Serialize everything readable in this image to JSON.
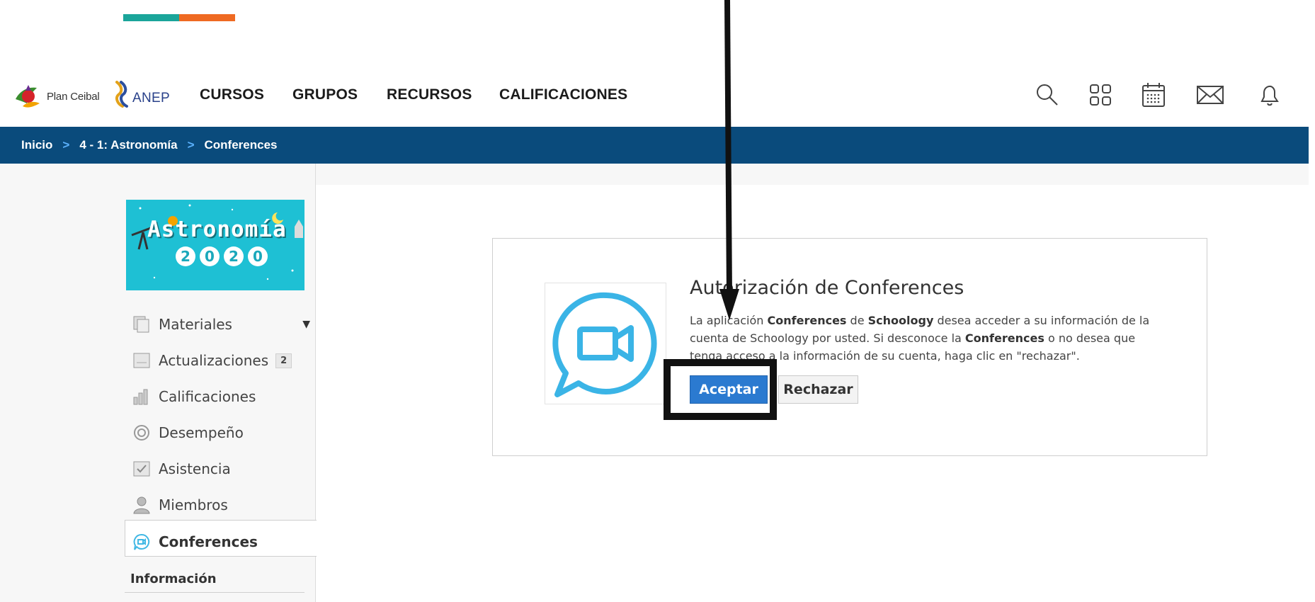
{
  "logos": {
    "ceibal_text": "Plan Ceibal",
    "anep_text": "ANEP"
  },
  "nav": {
    "items": [
      {
        "label": "CURSOS"
      },
      {
        "label": "GRUPOS"
      },
      {
        "label": "RECURSOS"
      },
      {
        "label": "CALIFICACIONES"
      }
    ],
    "icons": [
      "search-icon",
      "apps-grid-icon",
      "calendar-icon",
      "mail-icon",
      "bell-icon"
    ]
  },
  "breadcrumb": {
    "items": [
      "Inicio",
      "4 - 1: Astronomía",
      "Conferences"
    ],
    "separator": ">"
  },
  "course": {
    "image_title": "Astronomía",
    "image_year": [
      "2",
      "0",
      "2",
      "0"
    ]
  },
  "sidebar": {
    "items": [
      {
        "label": "Materiales",
        "icon": "materials-icon"
      },
      {
        "label": "Actualizaciones",
        "icon": "updates-icon",
        "badge": "2"
      },
      {
        "label": "Calificaciones",
        "icon": "grades-icon"
      },
      {
        "label": "Desempeño",
        "icon": "performance-icon"
      },
      {
        "label": "Asistencia",
        "icon": "attendance-icon"
      },
      {
        "label": "Miembros",
        "icon": "members-icon"
      },
      {
        "label": "Conferences",
        "icon": "conferences-icon",
        "active": true
      }
    ],
    "info_label": "Información"
  },
  "auth": {
    "title": "Autorización de Conferences",
    "text_parts": {
      "p1": "La aplicación ",
      "app": "Conferences",
      "p2": " de ",
      "platform": "Schoology",
      "p3": " desea acceder a su información de la cuenta de Schoology por usted. Si desconoce la ",
      "app2": "Conferences",
      "p4": " o no desea que tenga acceso a la información de su cuenta, haga clic en \"rechazar\"."
    },
    "accept_label": "Aceptar",
    "reject_label": "Rechazar"
  },
  "colors": {
    "breadcrumb_bg": "#0a4b7c",
    "accept_bg": "#2b7ad0",
    "accent_teal": "#1aa59a",
    "accent_orange": "#ef6a22"
  }
}
